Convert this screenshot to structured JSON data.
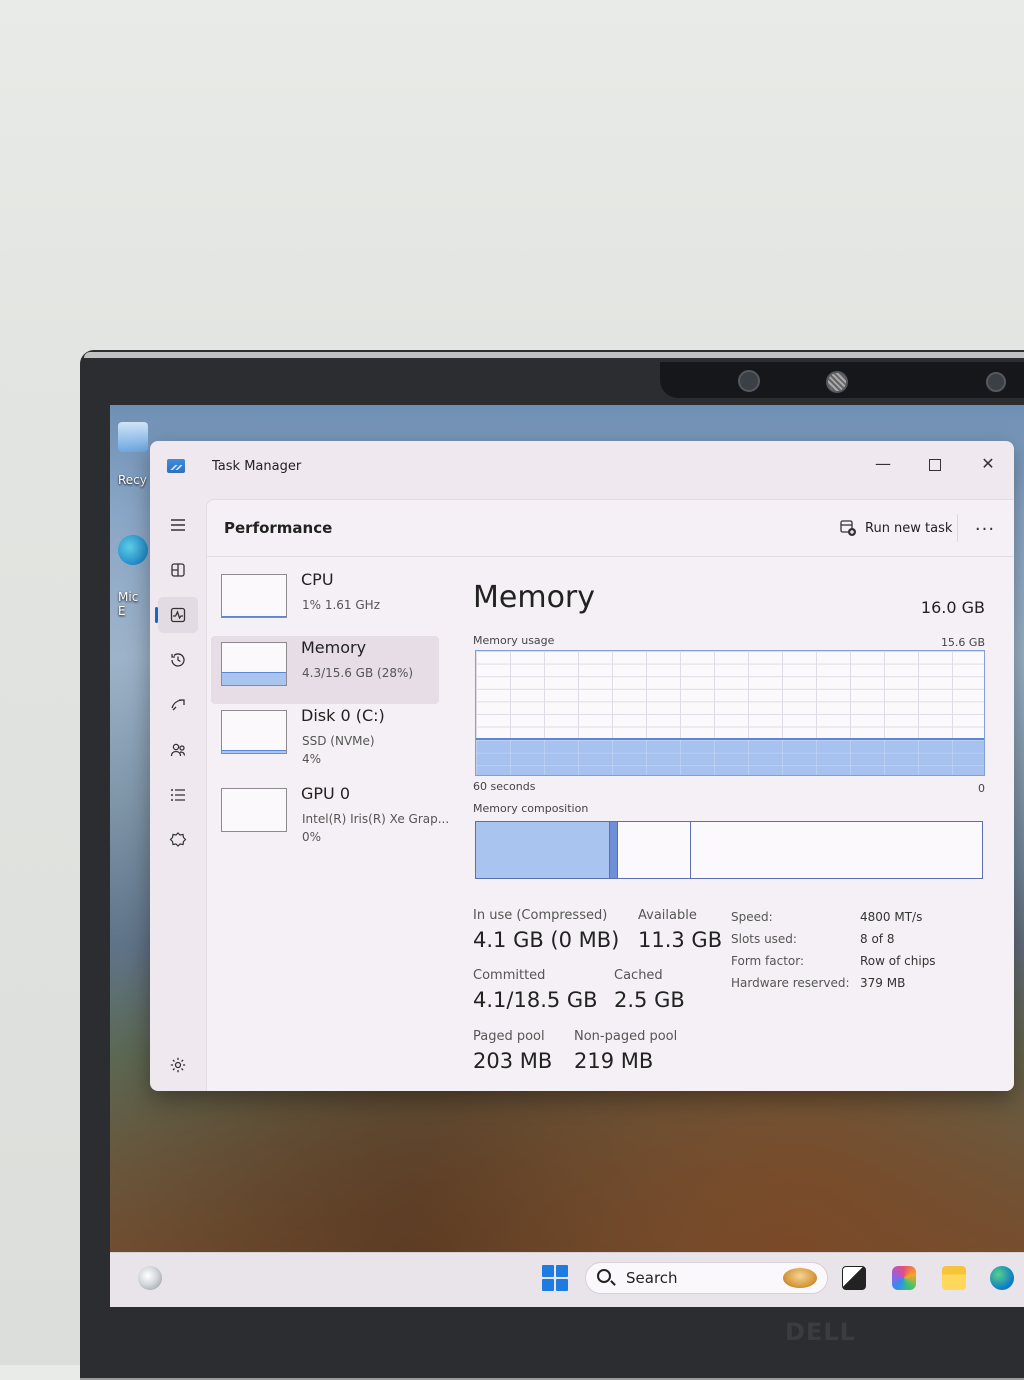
{
  "window": {
    "title": "Task Manager",
    "minimize_icon": "minimize-icon",
    "maximize_icon": "maximize-icon",
    "close_icon": "close-icon"
  },
  "nav": {
    "items": [
      {
        "name": "hamburger-menu-icon"
      },
      {
        "name": "processes-icon"
      },
      {
        "name": "performance-icon",
        "active": true
      },
      {
        "name": "app-history-icon"
      },
      {
        "name": "startup-apps-icon"
      },
      {
        "name": "users-icon"
      },
      {
        "name": "details-icon"
      },
      {
        "name": "services-icon"
      }
    ],
    "settings_icon": "settings-gear-icon"
  },
  "command_bar": {
    "page_title": "Performance",
    "run_new_task": "Run new task",
    "more": "..."
  },
  "perf_list": [
    {
      "name": "CPU",
      "sub1": "1%  1.61 GHz",
      "sub2": "",
      "fill": 0.01
    },
    {
      "name": "Memory",
      "sub1": "4.3/15.6 GB (28%)",
      "sub2": "",
      "fill": 0.28,
      "selected": true
    },
    {
      "name": "Disk 0 (C:)",
      "sub1": "SSD (NVMe)",
      "sub2": "4%",
      "fill": 0.04
    },
    {
      "name": "GPU 0",
      "sub1": "Intel(R) Iris(R) Xe Grap...",
      "sub2": "0%",
      "fill": 0.0
    }
  ],
  "detail": {
    "title": "Memory",
    "total": "16.0 GB",
    "usage_label": "Memory usage",
    "usage_max": "15.6 GB",
    "time_label": "60 seconds",
    "time_zero": "0",
    "usage_fraction": 0.28,
    "composition_label": "Memory composition",
    "composition": {
      "in_use": 0.265,
      "modified": 0.015,
      "standby": 0.145,
      "free": 0.575
    },
    "stats": {
      "in_use_label": "In use (Compressed)",
      "in_use_value": "4.1 GB (0 MB)",
      "available_label": "Available",
      "available_value": "11.3 GB",
      "committed_label": "Committed",
      "committed_value": "4.1/18.5 GB",
      "cached_label": "Cached",
      "cached_value": "2.5 GB",
      "paged_label": "Paged pool",
      "paged_value": "203 MB",
      "nonpaged_label": "Non-paged pool",
      "nonpaged_value": "219 MB"
    },
    "specs": [
      {
        "label": "Speed:",
        "value": "4800 MT/s"
      },
      {
        "label": "Slots used:",
        "value": "8 of 8"
      },
      {
        "label": "Form factor:",
        "value": "Row of chips"
      },
      {
        "label": "Hardware reserved:",
        "value": "379 MB"
      }
    ]
  },
  "taskbar": {
    "search_placeholder": "Search",
    "apps": [
      "weather-icon",
      "start-icon",
      "task-view-icon",
      "m365-copilot-icon",
      "file-explorer-icon",
      "edge-icon"
    ]
  },
  "desktop": {
    "icons": [
      {
        "label": "Recy",
        "name": "recycle-bin-icon"
      },
      {
        "label": "Mic\nE",
        "name": "edge-shortcut-icon"
      }
    ]
  },
  "hardware": {
    "brand": "DELL"
  },
  "colors": {
    "accent": "#1767c0",
    "memory_fill": "#a9c4ef",
    "memory_border": "#5c86d6"
  }
}
